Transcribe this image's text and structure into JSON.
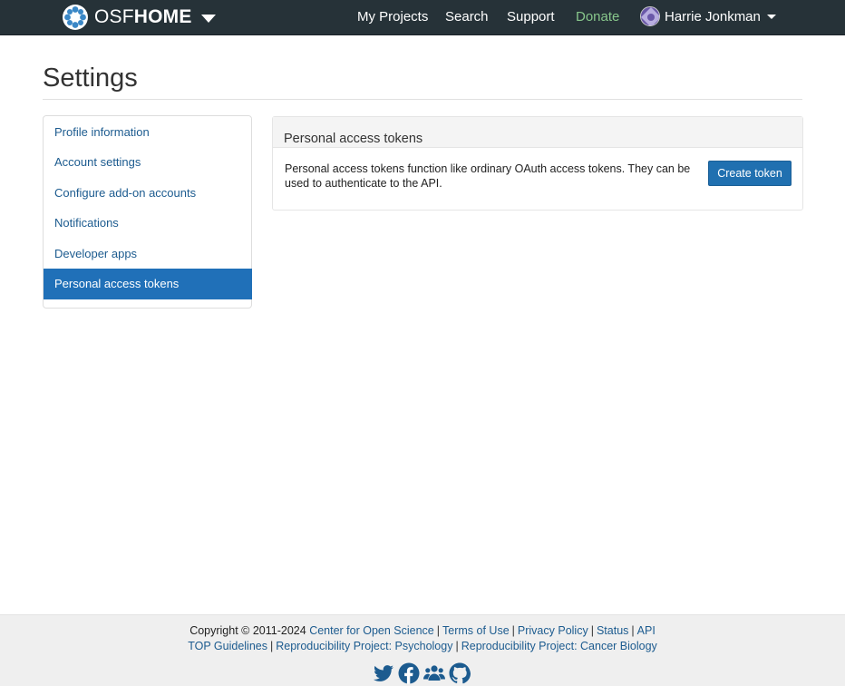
{
  "nav": {
    "brand_light": "OSF",
    "brand_bold": "HOME",
    "links": [
      "My Projects",
      "Search",
      "Support",
      "Donate"
    ],
    "user_name": "Harrie Jonkman"
  },
  "page": {
    "title": "Settings"
  },
  "sidebar": {
    "items": [
      {
        "label": "Profile information"
      },
      {
        "label": "Account settings"
      },
      {
        "label": "Configure add-on accounts"
      },
      {
        "label": "Notifications"
      },
      {
        "label": "Developer apps"
      },
      {
        "label": "Personal access tokens",
        "active": true
      }
    ]
  },
  "panel": {
    "title": "Personal access tokens",
    "text": "Personal access tokens function like ordinary OAuth access tokens. They can be used to authenticate to the API.",
    "button_label": "Create token"
  },
  "footer": {
    "copyright": "Copyright © 2011-2024",
    "line1_links": [
      "Center for Open Science",
      "Terms of Use",
      "Privacy Policy",
      "Status",
      "API"
    ],
    "line2_links": [
      "TOP Guidelines",
      "Reproducibility Project: Psychology",
      "Reproducibility Project: Cancer Biology"
    ],
    "social_icons": [
      "twitter-icon",
      "facebook-icon",
      "group-icon",
      "github-icon"
    ]
  },
  "colors": {
    "navbar": "#263238",
    "accent": "#2070b8",
    "link": "#1c5b8f",
    "donate": "#87c68b"
  }
}
